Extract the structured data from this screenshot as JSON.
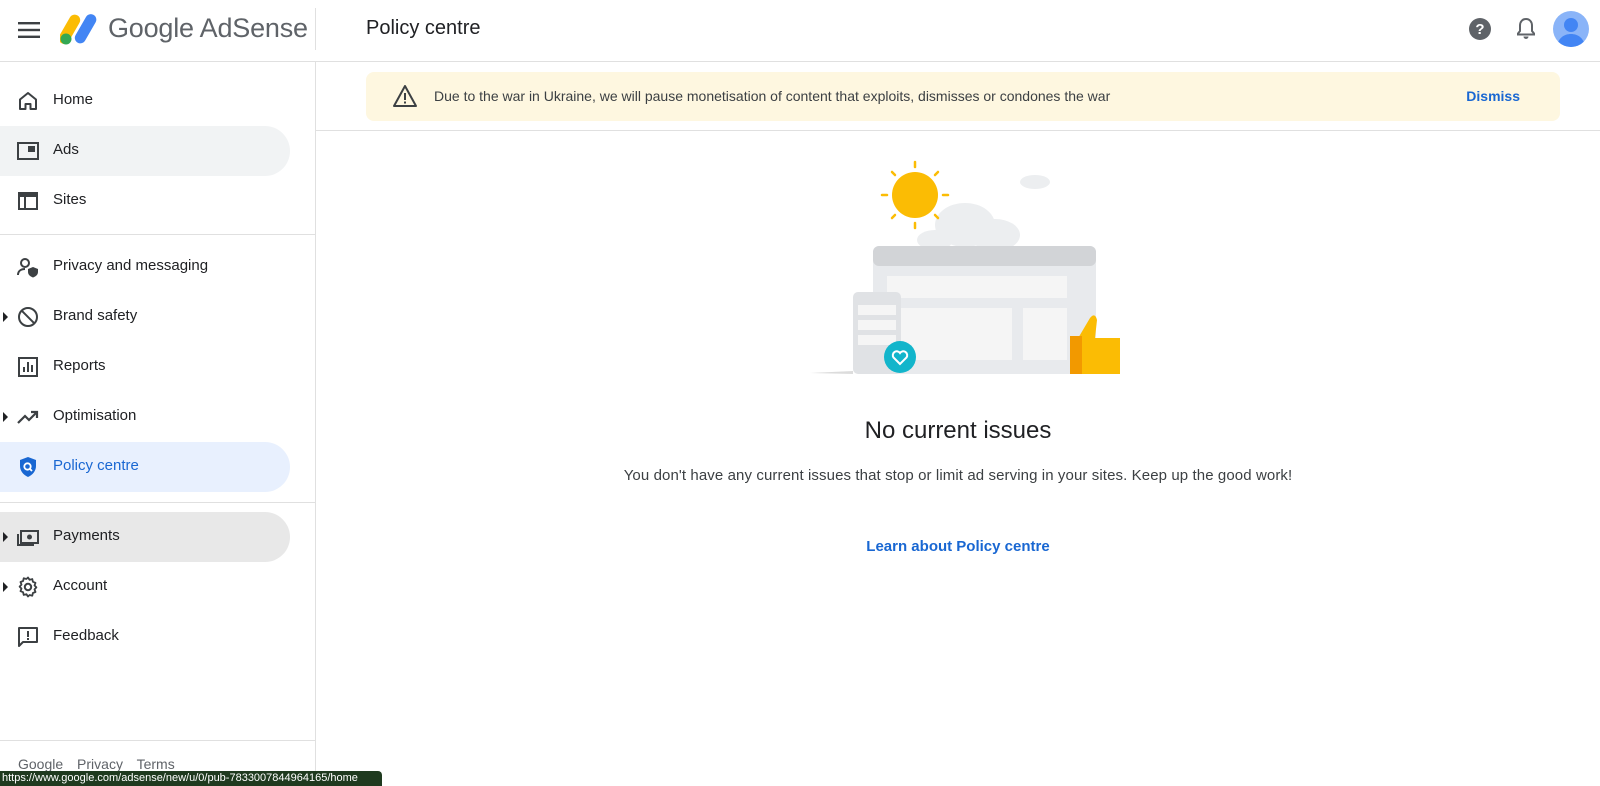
{
  "app": {
    "logo_text": "Google AdSense",
    "page_title": "Policy centre"
  },
  "sidebar": {
    "items": [
      {
        "label": "Home",
        "icon": "home-icon"
      },
      {
        "label": "Ads",
        "icon": "ads-icon"
      },
      {
        "label": "Sites",
        "icon": "sites-icon"
      },
      {
        "label": "Privacy and messaging",
        "icon": "privacy-icon"
      },
      {
        "label": "Brand safety",
        "icon": "block-icon"
      },
      {
        "label": "Reports",
        "icon": "reports-icon"
      },
      {
        "label": "Optimisation",
        "icon": "trending-icon"
      },
      {
        "label": "Policy centre",
        "icon": "policy-shield-icon"
      },
      {
        "label": "Payments",
        "icon": "payments-icon"
      },
      {
        "label": "Account",
        "icon": "gear-icon"
      },
      {
        "label": "Feedback",
        "icon": "feedback-icon"
      }
    ],
    "footer": [
      "Google",
      "Privacy",
      "Terms"
    ]
  },
  "status_url": "https://www.google.com/adsense/new/u/0/pub-7833007844964165/home",
  "banner": {
    "message": "Due to the war in Ukraine, we will pause monetisation of content that exploits, dismisses or condones the war",
    "dismiss_label": "Dismiss"
  },
  "main": {
    "headline": "No current issues",
    "subtext": "You don't have any current issues that stop or limit ad serving in your sites. Keep up the good work!",
    "learn_link": "Learn about Policy centre"
  },
  "colors": {
    "accent": "#1967d2",
    "active_bg": "#e8f0fe",
    "banner_bg": "#fef7e0"
  }
}
